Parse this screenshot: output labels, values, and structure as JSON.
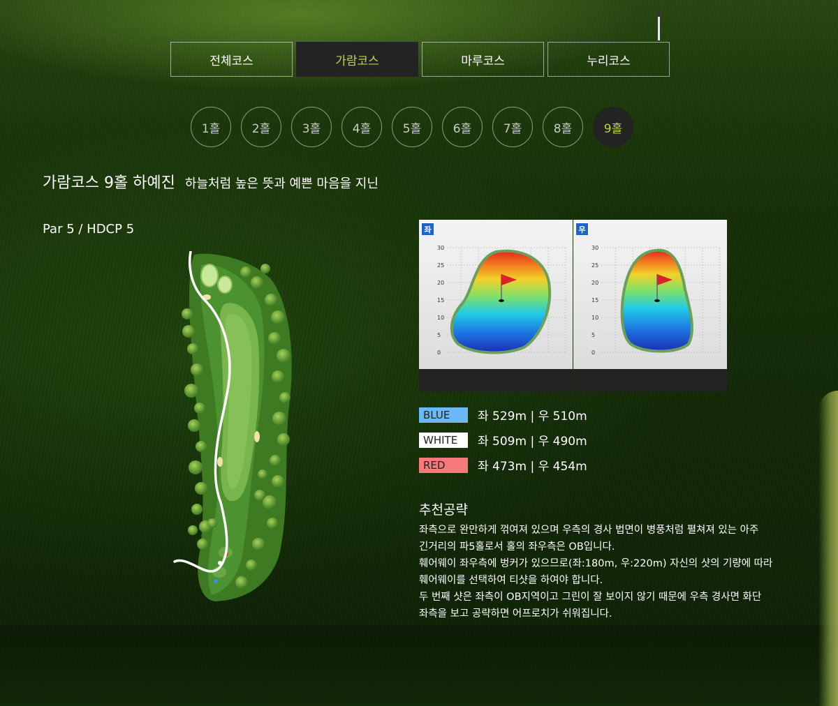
{
  "course_tabs": [
    {
      "label": "전체코스",
      "active": false
    },
    {
      "label": "가람코스",
      "active": true
    },
    {
      "label": "마루코스",
      "active": false
    },
    {
      "label": "누리코스",
      "active": false
    }
  ],
  "holes": [
    "1홀",
    "2홀",
    "3홀",
    "4홀",
    "5홀",
    "6홀",
    "7홀",
    "8홀",
    "9홀"
  ],
  "active_hole": "9홀",
  "title": {
    "main": "가람코스 9홀 하예진",
    "sub": "하늘처럼 높은 뜻과 예쁜 마음을 지닌"
  },
  "par_info": "Par 5 / HDCP 5",
  "green_panels": [
    {
      "badge": "좌",
      "y_ticks": [
        "30",
        "25",
        "20",
        "15",
        "10",
        "5",
        "0"
      ]
    },
    {
      "badge": "우",
      "y_ticks": [
        "30",
        "25",
        "20",
        "15",
        "10",
        "5",
        "0"
      ]
    }
  ],
  "tees": [
    {
      "label": "BLUE",
      "value": "좌 529m | 우 510m",
      "color": "#6bb8f7"
    },
    {
      "label": "WHITE",
      "value": "좌 509m | 우 490m",
      "color": "#ffffff"
    },
    {
      "label": "RED",
      "value": "좌 473m | 우 454m",
      "color": "#f77a7a"
    }
  ],
  "strategy": {
    "title": "추천공략",
    "lines": [
      "좌측으로 완만하게 꺾여져 있으며 우측의 경사 법면이 병풍처럼 펼쳐져 있는 아주",
      "긴거리의 파5홀로서 홀의 좌우측은 OB입니다.",
      "훼어웨이 좌우측에 벙커가 있으므로(좌:180m, 우:220m) 자신의 샷의 기량에 따라",
      "훼어웨이를 선택하여 티샷을 하여야 합니다.",
      "두 번째 샷은 좌측이 OB지역이고 그린이 잘 보이지 않기 때문에 우측 경사면 화단",
      "좌측을 보고 공략하면 어프로치가 쉬워집니다."
    ]
  },
  "colors": {
    "accent": "#b9d743",
    "active_bg": "#232323"
  }
}
